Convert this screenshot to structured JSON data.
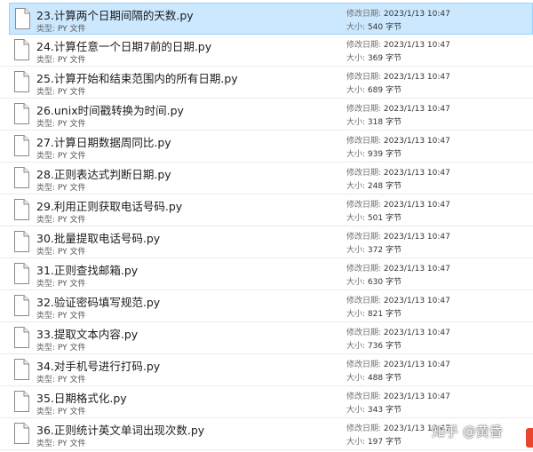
{
  "labels": {
    "type": "类型:",
    "modified": "修改日期:",
    "size": "大小:"
  },
  "files": [
    {
      "name": "23.计算两个日期间隔的天数.py",
      "type": "PY 文件",
      "modified": "2023/1/13 10:47",
      "size": "540 字节",
      "selected": true
    },
    {
      "name": "24.计算任意一个日期7前的日期.py",
      "type": "PY 文件",
      "modified": "2023/1/13 10:47",
      "size": "369 字节"
    },
    {
      "name": "25.计算开始和结束范围内的所有日期.py",
      "type": "PY 文件",
      "modified": "2023/1/13 10:47",
      "size": "689 字节"
    },
    {
      "name": "26.unix时间戳转换为时间.py",
      "type": "PY 文件",
      "modified": "2023/1/13 10:47",
      "size": "318 字节"
    },
    {
      "name": "27.计算日期数据周同比.py",
      "type": "PY 文件",
      "modified": "2023/1/13 10:47",
      "size": "939 字节"
    },
    {
      "name": "28.正则表达式判断日期.py",
      "type": "PY 文件",
      "modified": "2023/1/13 10:47",
      "size": "248 字节"
    },
    {
      "name": "29.利用正则获取电话号码.py",
      "type": "PY 文件",
      "modified": "2023/1/13 10:47",
      "size": "501 字节"
    },
    {
      "name": "30.批量提取电话号码.py",
      "type": "PY 文件",
      "modified": "2023/1/13 10:47",
      "size": "372 字节"
    },
    {
      "name": "31.正则查找邮箱.py",
      "type": "PY 文件",
      "modified": "2023/1/13 10:47",
      "size": "630 字节"
    },
    {
      "name": "32.验证密码填写规范.py",
      "type": "PY 文件",
      "modified": "2023/1/13 10:47",
      "size": "821 字节"
    },
    {
      "name": "33.提取文本内容.py",
      "type": "PY 文件",
      "modified": "2023/1/13 10:47",
      "size": "736 字节"
    },
    {
      "name": "34.对手机号进行打码.py",
      "type": "PY 文件",
      "modified": "2023/1/13 10:47",
      "size": "488 字节"
    },
    {
      "name": "35.日期格式化.py",
      "type": "PY 文件",
      "modified": "2023/1/13 10:47",
      "size": "343 字节"
    },
    {
      "name": "36.正则统计英文单词出现次数.py",
      "type": "PY 文件",
      "modified": "2023/1/13 10:47",
      "size": "197 字节"
    }
  ],
  "watermark": "知乎 @黄昏",
  "icons": {
    "file": "file-icon",
    "corner_badge": "badge-icon"
  },
  "colors": {
    "selection_bg": "#cce8ff",
    "selection_border": "#99d1ff",
    "badge": "#e8452c"
  }
}
